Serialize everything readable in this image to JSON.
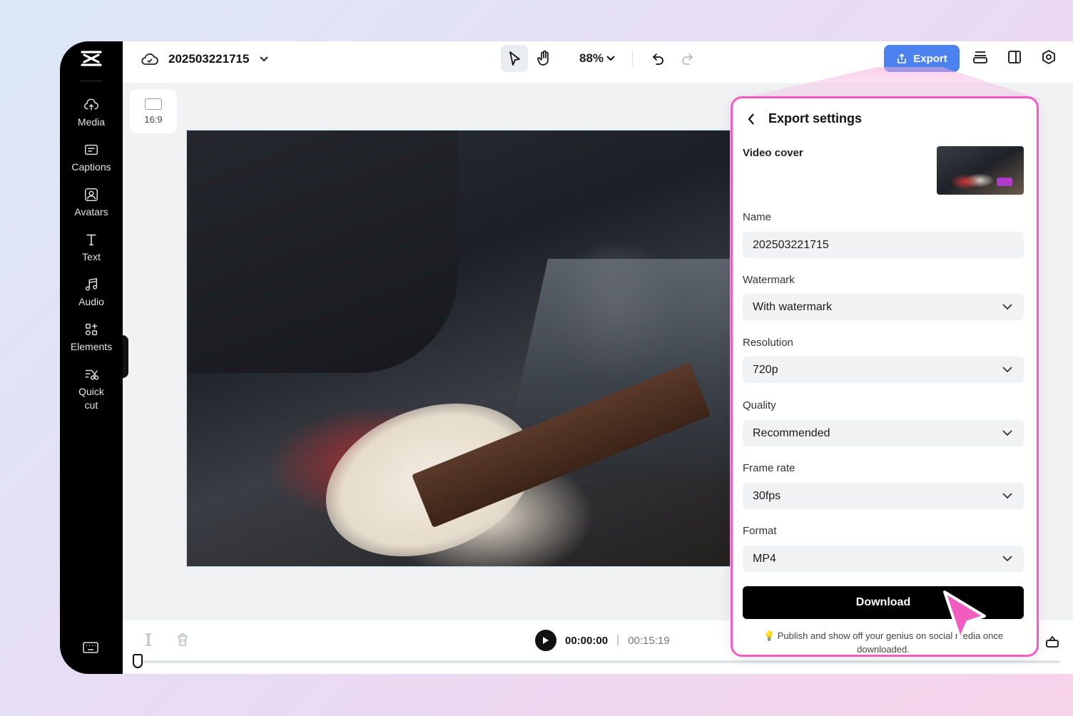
{
  "project": {
    "title": "202503221715"
  },
  "sidebar": {
    "items": [
      {
        "label": "Media",
        "icon": "cloud-upload-icon"
      },
      {
        "label": "Captions",
        "icon": "captions-icon"
      },
      {
        "label": "Avatars",
        "icon": "avatar-icon"
      },
      {
        "label": "Text",
        "icon": "text-icon"
      },
      {
        "label": "Audio",
        "icon": "music-note-icon"
      },
      {
        "label": "Elements",
        "icon": "elements-icon"
      },
      {
        "label": "Quick\ncut",
        "icon": "quick-cut-icon"
      }
    ]
  },
  "toolbar": {
    "zoom": "88%",
    "export_label": "Export"
  },
  "canvas": {
    "aspect_ratio": "16:9"
  },
  "timeline": {
    "current_time": "00:00:00",
    "separator": "|",
    "total_time": "00:15:19"
  },
  "export_panel": {
    "title": "Export settings",
    "cover_label": "Video cover",
    "name_label": "Name",
    "name_value": "202503221715",
    "watermark_label": "Watermark",
    "watermark_value": "With watermark",
    "resolution_label": "Resolution",
    "resolution_value": "720p",
    "quality_label": "Quality",
    "quality_value": "Recommended",
    "framerate_label": "Frame rate",
    "framerate_value": "30fps",
    "format_label": "Format",
    "format_value": "MP4",
    "download_label": "Download",
    "hint": "💡 Publish and show off your genius on social media once downloaded."
  },
  "colors": {
    "accent": "#4b82f0",
    "highlight": "#f35cc0",
    "download_bg": "#000000"
  }
}
